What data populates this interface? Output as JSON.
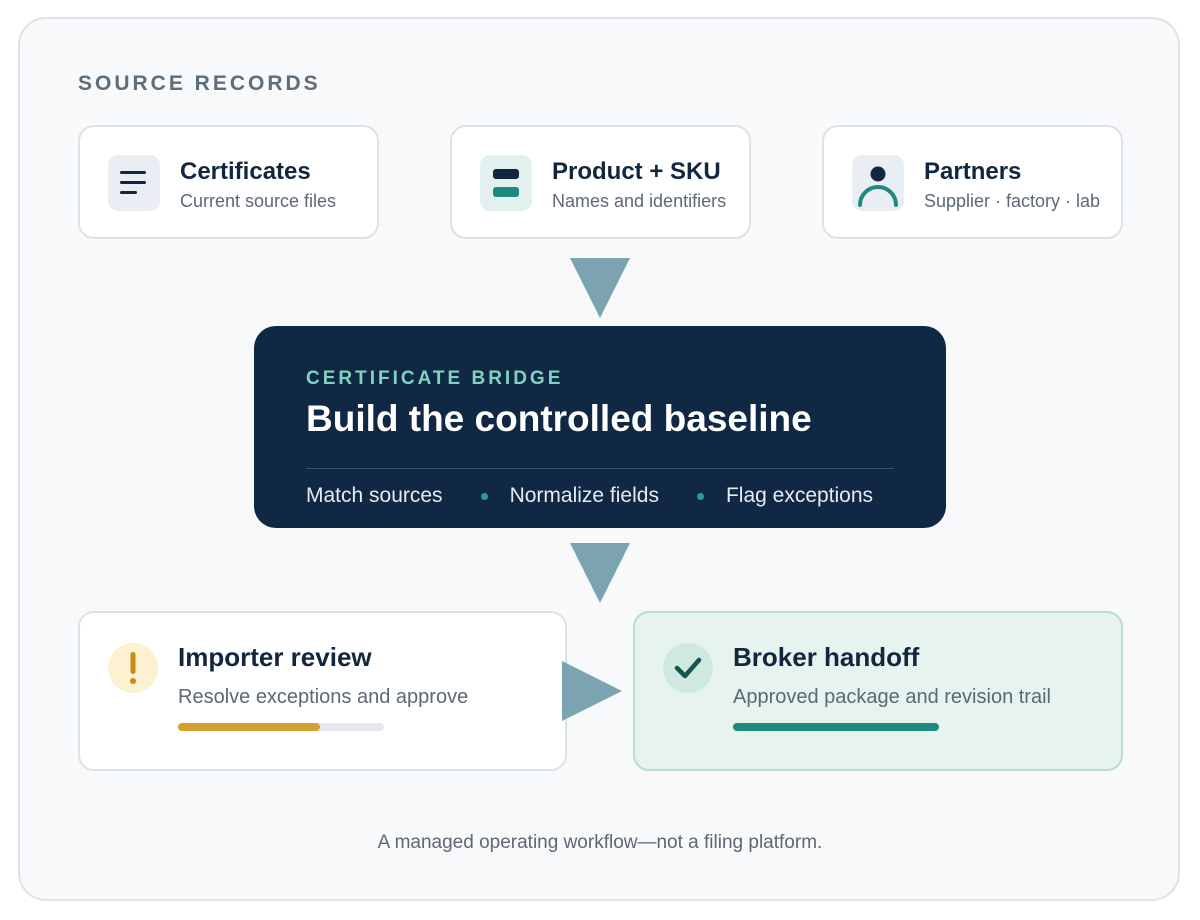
{
  "section_label": "SOURCE RECORDS",
  "sources": [
    {
      "title": "Certificates",
      "subtitle": "Current source files",
      "icon": "document-lines-icon"
    },
    {
      "title": "Product + SKU",
      "subtitle": "Names and identifiers",
      "icon": "sku-tag-icon"
    },
    {
      "title": "Partners",
      "subtitle": "Supplier · factory · lab",
      "icon": "person-icon"
    }
  ],
  "bridge": {
    "eyebrow": "CERTIFICATE BRIDGE",
    "headline": "Build the controlled baseline",
    "steps": [
      "Match sources",
      "Normalize fields",
      "Flag exceptions"
    ]
  },
  "review": {
    "title": "Importer review",
    "subtitle": "Resolve exceptions and approve",
    "icon": "exclamation-icon",
    "progress": 0.69
  },
  "handoff": {
    "title": "Broker handoff",
    "subtitle": "Approved package and revision trail",
    "icon": "checkmark-icon",
    "progress": 1.0
  },
  "footer": "A managed operating workflow—not a filing platform.",
  "colors": {
    "navy": "#112845",
    "teal": "#1e8a7e",
    "amber": "#d4a12e",
    "arrow": "#7ba3b0",
    "mint_bg": "#e6f3ef"
  }
}
